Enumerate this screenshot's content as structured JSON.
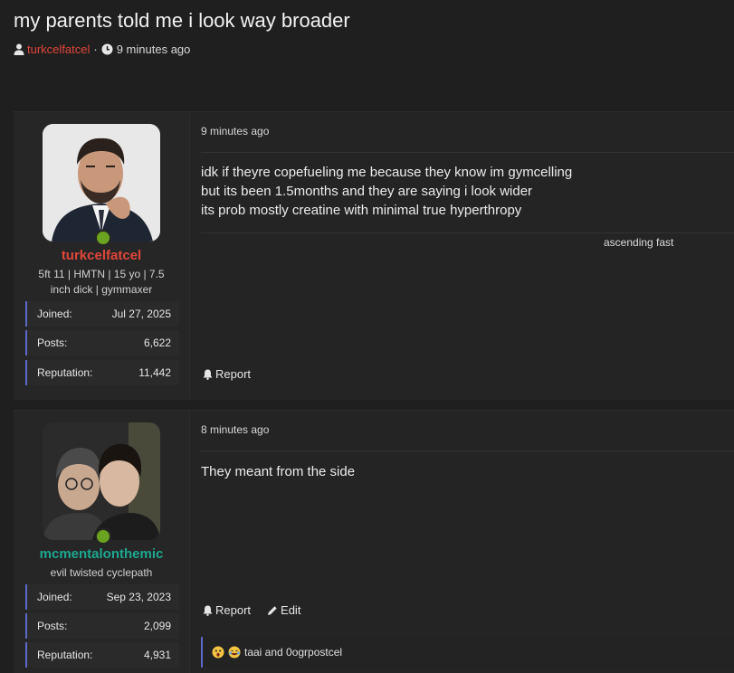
{
  "thread": {
    "title": "my parents told me i look way broader",
    "author": "turkcelfatcel",
    "separator": "·",
    "time": "9 minutes ago"
  },
  "posts": [
    {
      "username": "turkcelfatcel",
      "user_title": "5ft 11 | HMTN | 15 yo | 7.5 inch dick | gymmaxer",
      "stats": [
        {
          "label": "Joined:",
          "value": "Jul 27, 2025"
        },
        {
          "label": "Posts:",
          "value": "6,622"
        },
        {
          "label": "Reputation:",
          "value": "11,442"
        }
      ],
      "date": "9 minutes ago",
      "body": [
        "idk if theyre copefueling me because they know im gymcelling",
        "but its been 1.5months and they are saying i look wider",
        "its prob mostly creatine with minimal true hyperthropy"
      ],
      "signature": "ascending fast",
      "actions": {
        "report": "Report"
      }
    },
    {
      "username": "mcmentalonthemic",
      "user_title": "evil twisted cyclepath",
      "stats": [
        {
          "label": "Joined:",
          "value": "Sep 23, 2023"
        },
        {
          "label": "Posts:",
          "value": "2,099"
        },
        {
          "label": "Reputation:",
          "value": "4,931"
        }
      ],
      "date": "8 minutes ago",
      "body": [
        "They meant from the side"
      ],
      "actions": {
        "report": "Report",
        "edit": "Edit"
      },
      "reactions": {
        "text": "taai and 0ogrpostcel",
        "icons": [
          "shocked-emoji",
          "laughing-emoji"
        ]
      }
    }
  ],
  "colors": {
    "background": "#1f1f1f",
    "author_red": "#e0463a",
    "author_teal": "#1da890",
    "online_green": "#6aa31f",
    "accent_bar": "#5a68c8"
  }
}
